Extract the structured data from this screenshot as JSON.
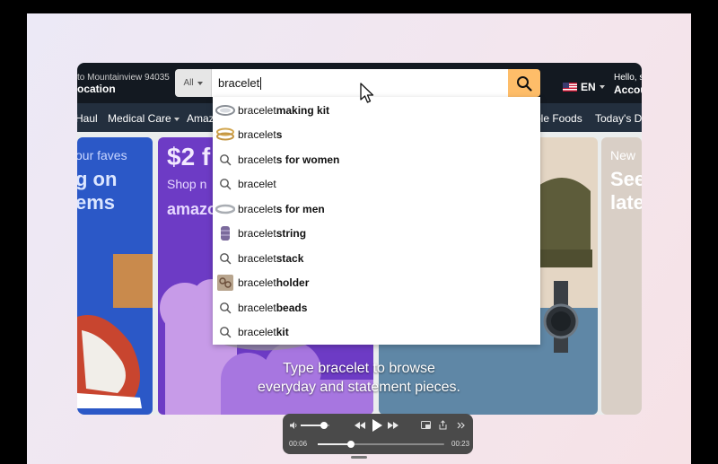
{
  "header": {
    "location_line1": "to Mountainview 94035",
    "location_line2": "ocation",
    "search_category": "All",
    "search_value": "bracelet",
    "language": "EN",
    "hello": "Hello, s",
    "account": "Accou"
  },
  "nav": {
    "items": [
      "Haul",
      "Medical Care",
      "Amaz",
      "ble Foods",
      "Today's De"
    ]
  },
  "cards": {
    "c1_line1": "our faves",
    "c1_line2": "g on",
    "c1_line3": "ems",
    "c2_line1": "$2 f",
    "c2_line2": "Shop n",
    "c2_line3": "amazo",
    "c4_line1": "New",
    "c4_line2": "See",
    "c4_line3": "late"
  },
  "suggestions": [
    {
      "prefix": "bracelet",
      "suffix": " making kit",
      "icon": "thumb-kit-icon"
    },
    {
      "prefix": "bracelet",
      "suffix": "s",
      "icon": "thumb-bracelets-icon"
    },
    {
      "prefix": "bracelet",
      "suffix": "s for women",
      "icon": "search-icon"
    },
    {
      "prefix": "bracelet",
      "suffix": "",
      "icon": "search-icon"
    },
    {
      "prefix": "bracelet",
      "suffix": "s for men",
      "icon": "thumb-men-icon"
    },
    {
      "prefix": "bracelet",
      "suffix": " string",
      "icon": "thumb-string-icon"
    },
    {
      "prefix": "bracelet",
      "suffix": " stack",
      "icon": "search-icon"
    },
    {
      "prefix": "bracelet",
      "suffix": " holder",
      "icon": "thumb-holder-icon"
    },
    {
      "prefix": "bracelet",
      "suffix": " beads",
      "icon": "search-icon"
    },
    {
      "prefix": "bracelet",
      "suffix": " kit",
      "icon": "search-icon"
    }
  ],
  "caption": {
    "line1": "Type bracelet to browse",
    "line2": "everyday and statement pieces."
  },
  "player": {
    "time_current": "00:06",
    "time_total": "00:23",
    "progress_fraction": 0.26,
    "volume_fraction": 0.8
  },
  "colors": {
    "topbar": "#131921",
    "navbar": "#232f3e",
    "search_button": "#febd69"
  }
}
